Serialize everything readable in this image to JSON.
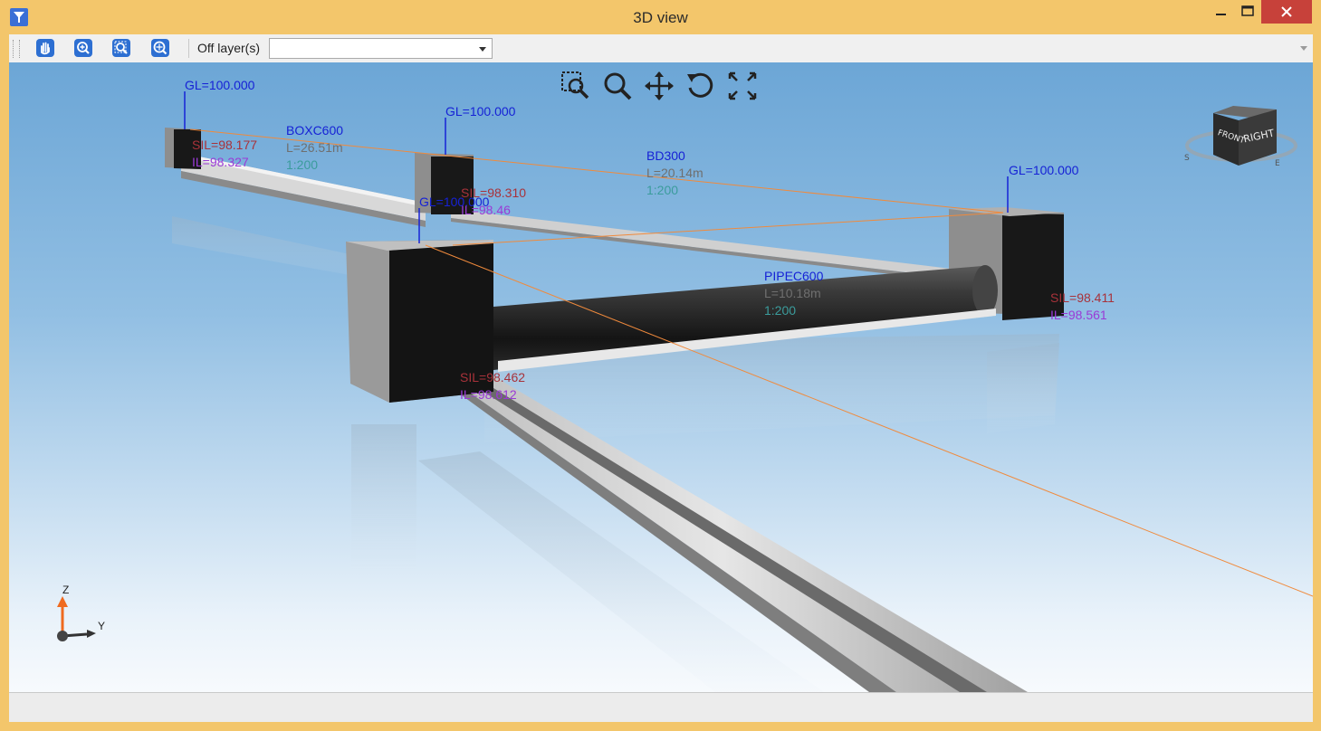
{
  "window": {
    "title": "3D view"
  },
  "toolbar": {
    "off_layer_label": "Off layer(s)",
    "off_layer_value": ""
  },
  "labels": {
    "gl_a": "GL=100.000",
    "gl_b": "GL=100.000",
    "gl_c": "GL=100.000",
    "gl_d": "GL=100.000",
    "sil_a": "SIL=98.177",
    "il_a": "IL=98.327",
    "sil_b": "SIL=98.310",
    "il_b": "IL=98.46",
    "sil_c": "SIL=98.462",
    "il_c": "IL=98.612",
    "sil_d": "SIL=98.411",
    "il_d": "IL=98.561",
    "pipe1_name": "BOXC600",
    "pipe1_length": "L=26.51m",
    "pipe1_grade": "1:200",
    "pipe2_name": "BD300",
    "pipe2_length": "L=20.14m",
    "pipe2_grade": "1:200",
    "pipe3_name": "PIPEC600",
    "pipe3_length": "L=10.18m",
    "pipe3_grade": "1:200"
  },
  "view_cube": {
    "front_label": "FRONT",
    "right_label": "RIGHT",
    "compass_s": "S",
    "compass_e": "E"
  },
  "axis": {
    "z": "Z",
    "y": "Y"
  },
  "colors": {
    "title_bar": "#f3c66b",
    "close_button": "#c7413a",
    "label_blue": "#1622d6",
    "label_red": "#a8323a",
    "label_purple": "#9a3ad6",
    "guide_line": "#f08a3c"
  }
}
